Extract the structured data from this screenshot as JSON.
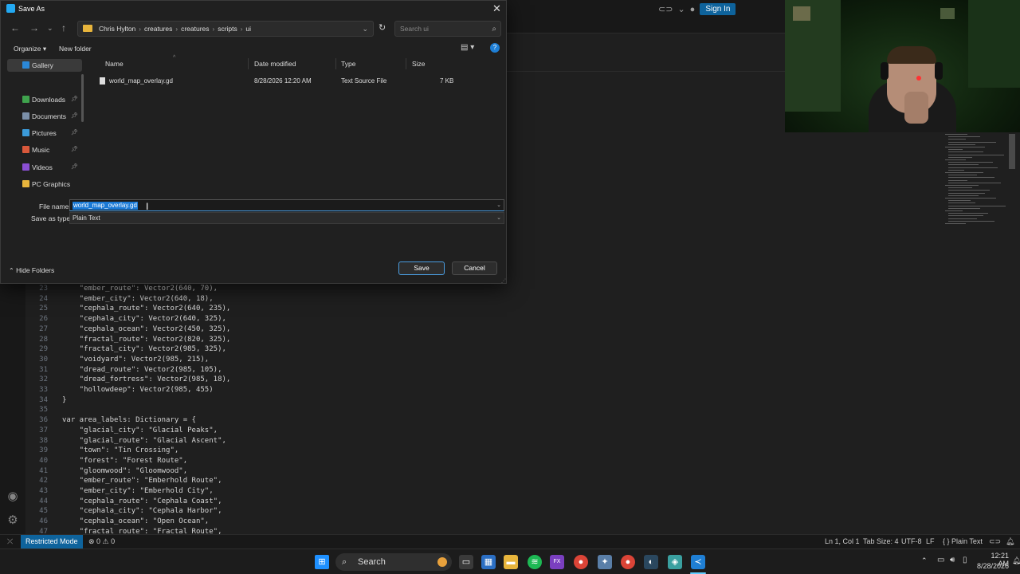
{
  "vscode": {
    "signin_label": "Sign In",
    "code_lines": [
      {
        "n": "23",
        "t": "    \"ember_route\": Vector2(640, 70),"
      },
      {
        "n": "24",
        "t": "    \"ember_city\": Vector2(640, 18),"
      },
      {
        "n": "25",
        "t": "    \"cephala_route\": Vector2(640, 235),"
      },
      {
        "n": "26",
        "t": "    \"cephala_city\": Vector2(640, 325),"
      },
      {
        "n": "27",
        "t": "    \"cephala_ocean\": Vector2(450, 325),"
      },
      {
        "n": "28",
        "t": "    \"fractal_route\": Vector2(820, 325),"
      },
      {
        "n": "29",
        "t": "    \"fractal_city\": Vector2(985, 325),"
      },
      {
        "n": "30",
        "t": "    \"voidyard\": Vector2(985, 215),"
      },
      {
        "n": "31",
        "t": "    \"dread_route\": Vector2(985, 105),"
      },
      {
        "n": "32",
        "t": "    \"dread_fortress\": Vector2(985, 18),"
      },
      {
        "n": "33",
        "t": "    \"hollowdeep\": Vector2(985, 455)"
      },
      {
        "n": "34",
        "t": "}"
      },
      {
        "n": "35",
        "t": ""
      },
      {
        "n": "36",
        "t": "var area_labels: Dictionary = {"
      },
      {
        "n": "37",
        "t": "    \"glacial_city\": \"Glacial Peaks\","
      },
      {
        "n": "38",
        "t": "    \"glacial_route\": \"Glacial Ascent\","
      },
      {
        "n": "39",
        "t": "    \"town\": \"Tin Crossing\","
      },
      {
        "n": "40",
        "t": "    \"forest\": \"Forest Route\","
      },
      {
        "n": "41",
        "t": "    \"gloomwood\": \"Gloomwood\","
      },
      {
        "n": "42",
        "t": "    \"ember_route\": \"Emberhold Route\","
      },
      {
        "n": "43",
        "t": "    \"ember_city\": \"Emberhold City\","
      },
      {
        "n": "44",
        "t": "    \"cephala_route\": \"Cephala Coast\","
      },
      {
        "n": "45",
        "t": "    \"cephala_city\": \"Cephala Harbor\","
      },
      {
        "n": "46",
        "t": "    \"cephala_ocean\": \"Open Ocean\","
      },
      {
        "n": "47",
        "t": "    \"fractal_route\": \"Fractal Route\","
      }
    ],
    "status": {
      "restricted": "Restricted Mode",
      "problems": "⊗ 0 ⚠ 0",
      "cursor": "Ln 1, Col 1",
      "tab_size": "Tab Size: 4",
      "encoding": "UTF-8",
      "eol": "LF",
      "language": "{ } Plain Text"
    }
  },
  "dialog": {
    "title": "Save As",
    "breadcrumb": [
      "Chris Hylton",
      "creatures",
      "creatures",
      "scripts",
      "ui"
    ],
    "search_placeholder": "Search ui",
    "organize_label": "Organize ▾",
    "new_folder_label": "New folder",
    "nav_items": [
      {
        "label": "Gallery",
        "color": "#2b88d8"
      },
      {
        "label": "Downloads",
        "color": "#3fa34d"
      },
      {
        "label": "Documents",
        "color": "#7b8fa8"
      },
      {
        "label": "Pictures",
        "color": "#3b9ad9"
      },
      {
        "label": "Music",
        "color": "#d8583b"
      },
      {
        "label": "Videos",
        "color": "#8a4fd3"
      },
      {
        "label": "PC Graphics",
        "color": "#e8b53c"
      }
    ],
    "columns": {
      "name": "Name",
      "date": "Date modified",
      "type": "Type",
      "size": "Size"
    },
    "files": [
      {
        "name": "world_map_overlay.gd",
        "date": "8/28/2026 12:20 AM",
        "type": "Text Source File",
        "size": "7 KB"
      }
    ],
    "file_name_label": "File name:",
    "file_name_value": "world_map_overlay.gd",
    "save_type_label": "Save as type:",
    "save_type_value": "Plain Text",
    "hide_folders_label": "Hide Folders",
    "save_label": "Save",
    "cancel_label": "Cancel"
  },
  "taskbar": {
    "search_label": "Search",
    "time": "12:21 AM",
    "date": "8/28/2026"
  },
  "colors": {
    "accent": "#0e639c",
    "selection": "#1979d6"
  }
}
